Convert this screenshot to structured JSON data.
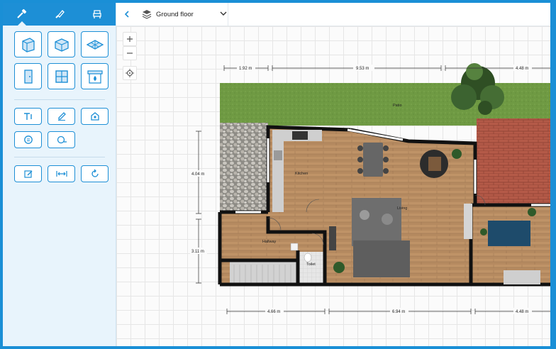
{
  "sidebar": {
    "tabs": [
      {
        "icon": "hammer-icon"
      },
      {
        "icon": "paint-brush-icon"
      },
      {
        "icon": "furniture-icon"
      }
    ],
    "build_tools": [
      {
        "icon": "wall-icon"
      },
      {
        "icon": "room-icon"
      },
      {
        "icon": "floor-icon"
      },
      {
        "icon": "door-icon"
      },
      {
        "icon": "window-icon"
      },
      {
        "icon": "fireplace-icon"
      }
    ],
    "annotation_tools": [
      {
        "icon": "text-icon"
      },
      {
        "icon": "pencil-icon"
      },
      {
        "icon": "label-icon"
      },
      {
        "icon": "measure-icon"
      },
      {
        "icon": "tape-icon"
      }
    ],
    "edit_tools": [
      {
        "icon": "edit-icon"
      },
      {
        "icon": "dimension-icon"
      },
      {
        "icon": "rotate-icon"
      }
    ]
  },
  "topbar": {
    "floor_name": "Ground floor"
  },
  "canvas": {
    "dimensions_top": [
      "1.92 m",
      "9.53 m",
      "4.48 m"
    ],
    "dimensions_left": [
      "4.04 m",
      "3.11 m"
    ],
    "dimensions_bottom": [
      "4.66 m",
      "6.94 m",
      "4.48 m"
    ],
    "rooms": {
      "patio": "Patio",
      "kitchen": "Kitchen",
      "living": "Living",
      "hallway": "Hallway",
      "toilet": "Toilet"
    }
  },
  "colors": {
    "accent": "#1d8fd6",
    "sidebar_bg": "#e8f4fc",
    "wood": "#b58a60",
    "grass": "#6f9a43",
    "brick": "#b45a48"
  }
}
